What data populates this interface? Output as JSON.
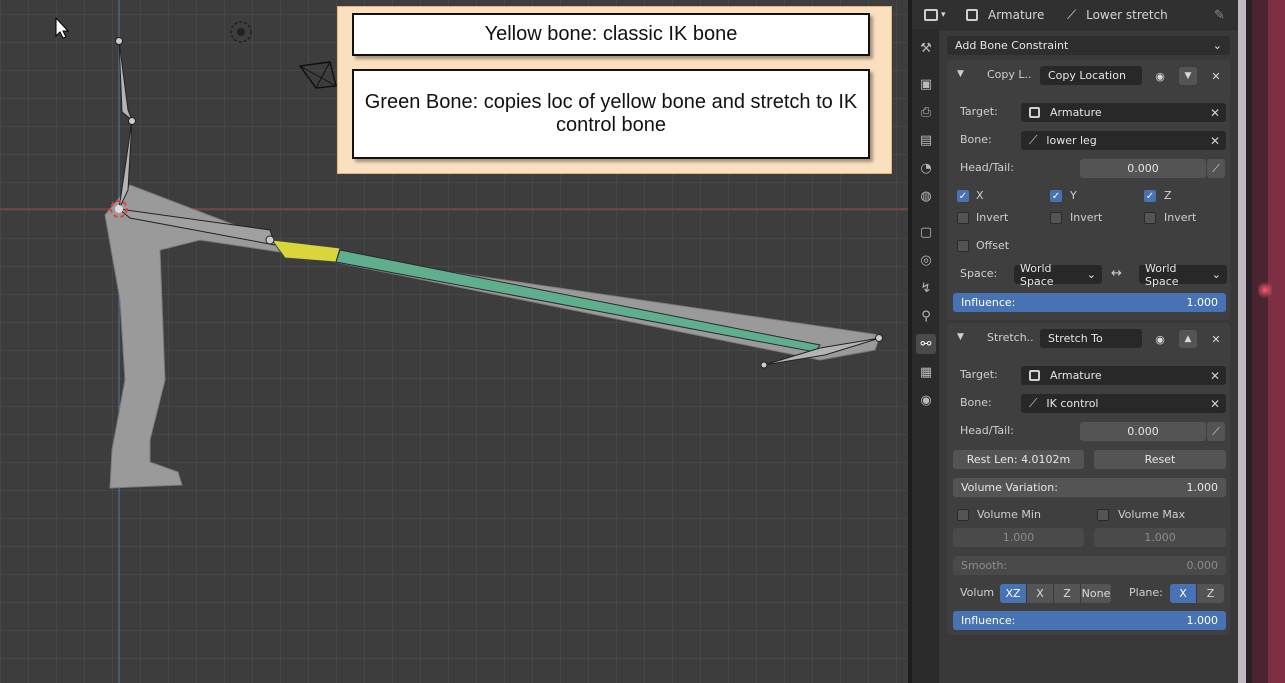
{
  "annotations": {
    "yellow_note": "Yellow bone: classic IK bone",
    "green_note": "Green Bone: copies loc of yellow bone and stretch to IK control bone"
  },
  "header": {
    "object_name": "Armature",
    "bone_name": "Lower stretch"
  },
  "add_constraint_label": "Add Bone Constraint",
  "copy_location": {
    "short_title": "Copy L..",
    "name": "Copy Location",
    "target_label": "Target:",
    "target_value": "Armature",
    "bone_label": "Bone:",
    "bone_value": "lower leg",
    "headtail_label": "Head/Tail:",
    "headtail_value": "0.000",
    "axis_x": "X",
    "axis_y": "Y",
    "axis_z": "Z",
    "invert_label": "Invert",
    "offset_label": "Offset",
    "space_label": "Space:",
    "space_owner": "World Space",
    "space_target": "World Space",
    "influence_label": "Influence:",
    "influence_value": "1.000"
  },
  "stretch_to": {
    "short_title": "Stretch..",
    "name": "Stretch To",
    "target_label": "Target:",
    "target_value": "Armature",
    "bone_label": "Bone:",
    "bone_value": "IK control",
    "headtail_label": "Head/Tail:",
    "headtail_value": "0.000",
    "rest_len_label": "Rest Len:",
    "rest_len_value": "4.0102m",
    "reset_label": "Reset",
    "volume_variation_label": "Volume Variation:",
    "volume_variation_value": "1.000",
    "volume_min_label": "Volume Min",
    "volume_max_label": "Volume Max",
    "volume_min_value": "1.000",
    "volume_max_value": "1.000",
    "smooth_label": "Smooth:",
    "smooth_value": "0.000",
    "volume_label": "Volum",
    "volume_options": [
      "XZ",
      "X",
      "Z",
      "None"
    ],
    "plane_label": "Plane:",
    "plane_options": [
      "X",
      "Z"
    ],
    "influence_label": "Influence:",
    "influence_value": "1.000"
  },
  "colors": {
    "accent": "#4772b3",
    "ik_bone": "#d8d63a",
    "stretch_bone": "#5fae8e",
    "viewport_bg": "#3d3d3d"
  }
}
